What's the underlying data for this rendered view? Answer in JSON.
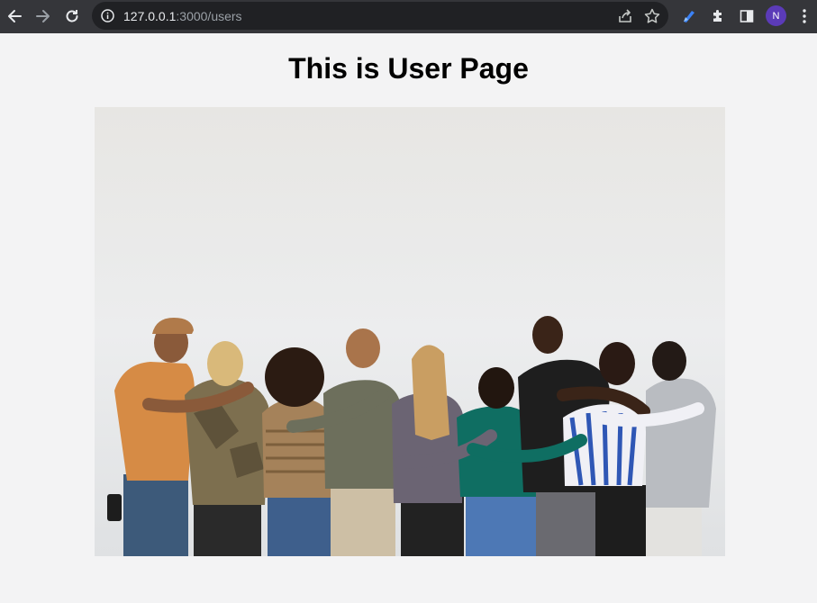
{
  "browser": {
    "url_host": "127.0.0.1",
    "url_path": ":3000/users",
    "avatar_letter": "N",
    "icons": [
      "back-arrow-icon",
      "forward-arrow-icon",
      "reload-icon",
      "info-icon",
      "share-icon",
      "star-icon",
      "extension-blue-icon",
      "puzzle-icon",
      "side-panel-icon",
      "kebab-menu-icon"
    ]
  },
  "page": {
    "title": "This is User Page",
    "image": {
      "subject": "group-photo",
      "colors": {
        "wall": "#e9ebec",
        "floor_shadow": "#d6d8da"
      }
    }
  },
  "theme": {
    "toolbar_bg": "#35363a",
    "omnibox_bg": "#202124",
    "page_bg": "#f3f3f4",
    "avatar_bg": "#5b3bb8"
  }
}
